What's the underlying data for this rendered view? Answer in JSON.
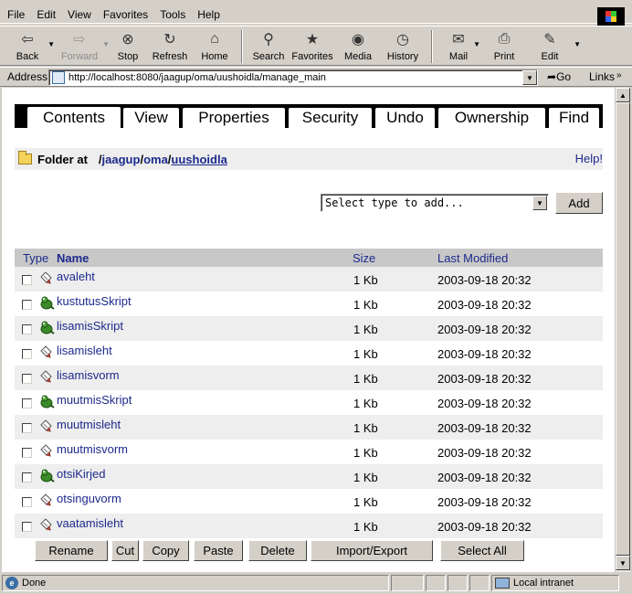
{
  "menu": [
    "File",
    "Edit",
    "View",
    "Favorites",
    "Tools",
    "Help"
  ],
  "toolbar": [
    {
      "label": "Back",
      "icon": "back-arrow-icon"
    },
    {
      "label": "Forward",
      "icon": "forward-arrow-icon"
    },
    {
      "label": "Stop",
      "icon": "stop-icon"
    },
    {
      "label": "Refresh",
      "icon": "refresh-icon"
    },
    {
      "label": "Home",
      "icon": "home-icon"
    },
    {
      "label": "Search",
      "icon": "search-icon"
    },
    {
      "label": "Favorites",
      "icon": "favorites-icon"
    },
    {
      "label": "Media",
      "icon": "media-icon"
    },
    {
      "label": "History",
      "icon": "history-icon"
    },
    {
      "label": "Mail",
      "icon": "mail-icon"
    },
    {
      "label": "Print",
      "icon": "print-icon"
    },
    {
      "label": "Edit",
      "icon": "edit-icon"
    }
  ],
  "address": {
    "label": "Address",
    "url": "http://localhost:8080/jaagup/oma/uushoidla/manage_main",
    "go": "Go",
    "links": "Links"
  },
  "tabs": [
    "Contents",
    "View",
    "Properties",
    "Security",
    "Undo",
    "Ownership",
    "Find"
  ],
  "breadcrumb": {
    "label": "Folder at",
    "sep": "/",
    "parts": [
      "jaagup",
      "oma",
      "uushoidla"
    ],
    "help": "Help!"
  },
  "add": {
    "select_value": "Select type to add...",
    "button": "Add"
  },
  "table": {
    "headers": {
      "type": "Type",
      "name": "Name",
      "size": "Size",
      "modified": "Last Modified"
    },
    "rows": [
      {
        "name": "avaleht",
        "kind": "page",
        "size": "1 Kb",
        "modified": "2003-09-18 20:32"
      },
      {
        "name": "kustutusSkript",
        "kind": "script",
        "size": "1 Kb",
        "modified": "2003-09-18 20:32"
      },
      {
        "name": "lisamisSkript",
        "kind": "script",
        "size": "1 Kb",
        "modified": "2003-09-18 20:32"
      },
      {
        "name": "lisamisleht",
        "kind": "page",
        "size": "1 Kb",
        "modified": "2003-09-18 20:32"
      },
      {
        "name": "lisamisvorm",
        "kind": "page",
        "size": "1 Kb",
        "modified": "2003-09-18 20:32"
      },
      {
        "name": "muutmisSkript",
        "kind": "script",
        "size": "1 Kb",
        "modified": "2003-09-18 20:32"
      },
      {
        "name": "muutmisleht",
        "kind": "page",
        "size": "1 Kb",
        "modified": "2003-09-18 20:32"
      },
      {
        "name": "muutmisvorm",
        "kind": "page",
        "size": "1 Kb",
        "modified": "2003-09-18 20:32"
      },
      {
        "name": "otsiKirjed",
        "kind": "script",
        "size": "1 Kb",
        "modified": "2003-09-18 20:32"
      },
      {
        "name": "otsinguvorm",
        "kind": "page",
        "size": "1 Kb",
        "modified": "2003-09-18 20:32"
      },
      {
        "name": "vaatamisleht",
        "kind": "page",
        "size": "1 Kb",
        "modified": "2003-09-18 20:32"
      }
    ]
  },
  "actions": [
    "Rename",
    "Cut",
    "Copy",
    "Paste",
    "Delete",
    "Import/Export",
    "Select All"
  ],
  "status": {
    "text": "Done",
    "zone": "Local intranet"
  },
  "colors": {
    "link": "#1c2a8c",
    "chrome": "#d4d0c8",
    "row_alt": "#eeeeee",
    "header_bg": "#c8c8c8"
  }
}
